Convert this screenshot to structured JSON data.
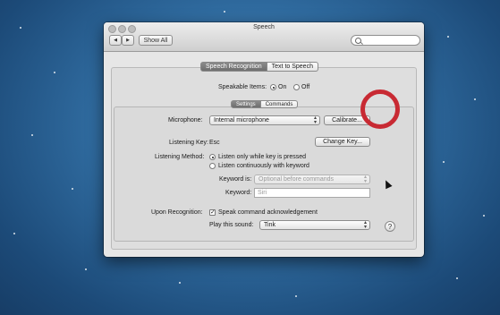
{
  "window": {
    "title": "Speech",
    "show_all": "Show All",
    "back_arrow": "◀",
    "forward_arrow": "▶"
  },
  "tabs": [
    {
      "label": "Speech Recognition",
      "active": true
    },
    {
      "label": "Text to Speech",
      "active": false
    }
  ],
  "speakable": {
    "label": "Speakable Items:",
    "on": "On",
    "off": "Off",
    "selected": "On"
  },
  "subtabs": [
    {
      "label": "Settings",
      "active": true
    },
    {
      "label": "Commands",
      "active": false
    }
  ],
  "microphone": {
    "label": "Microphone:",
    "value": "Internal microphone",
    "calibrate": "Calibrate..."
  },
  "listening_key": {
    "label": "Listening Key:",
    "value": "Esc",
    "change": "Change Key..."
  },
  "listening_method": {
    "label": "Listening Method:",
    "option1": "Listen only while key is pressed",
    "option2": "Listen continuously with keyword",
    "selected": "option1"
  },
  "keyword_is": {
    "label": "Keyword is:",
    "value": "Optional before commands"
  },
  "keyword": {
    "label": "Keyword:",
    "value": "Siri"
  },
  "upon_recognition": {
    "label": "Upon Recognition:",
    "checkbox": "Speak command acknowledgement",
    "checked": true
  },
  "play_sound": {
    "label": "Play this sound:",
    "value": "Tink"
  },
  "help": "?"
}
